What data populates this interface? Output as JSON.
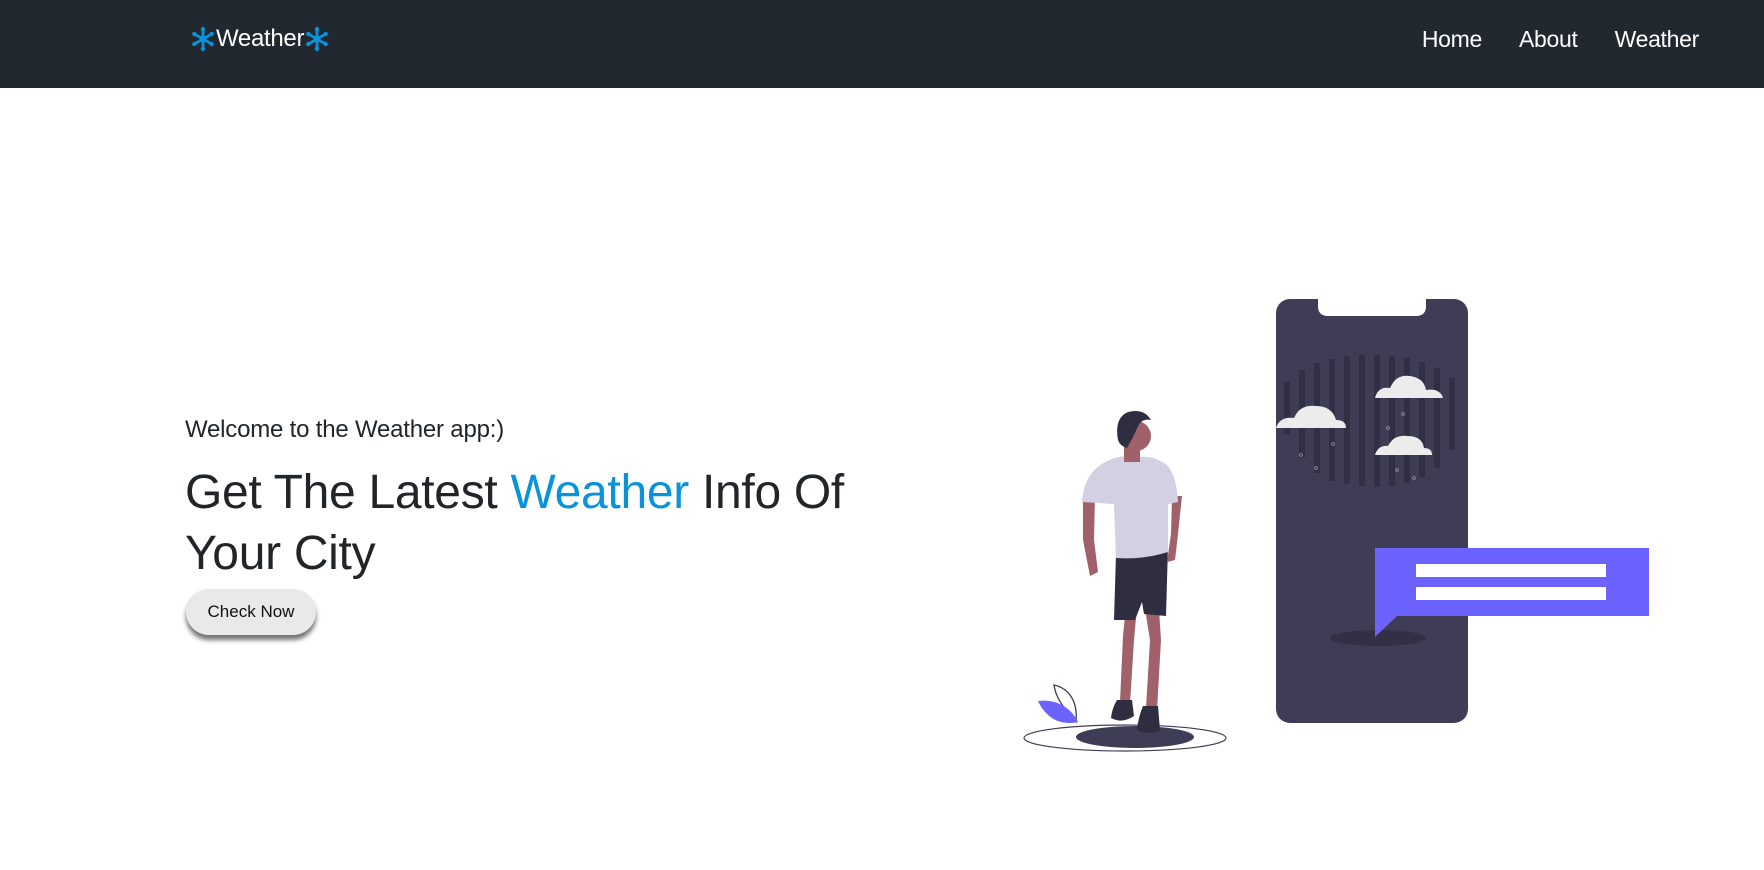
{
  "navbar": {
    "brand_label": "Weather",
    "brand_icon": "snowflake-icon",
    "brand_icon_color": "#0a93db",
    "background_color": "#212830",
    "links": [
      {
        "label": "Home"
      },
      {
        "label": "About"
      },
      {
        "label": "Weather"
      }
    ]
  },
  "hero": {
    "welcome_text": "Welcome to the Weather app:)",
    "headline_before": "Get The Latest ",
    "headline_accent": "Weather",
    "headline_after": " Info Of Your City",
    "accent_color": "#0a93db",
    "cta_label": "Check Now"
  },
  "illustration": {
    "name": "man-with-phone-weather-illustration",
    "phone_color": "#3f3d56",
    "bubble_color": "#6c63ff"
  }
}
